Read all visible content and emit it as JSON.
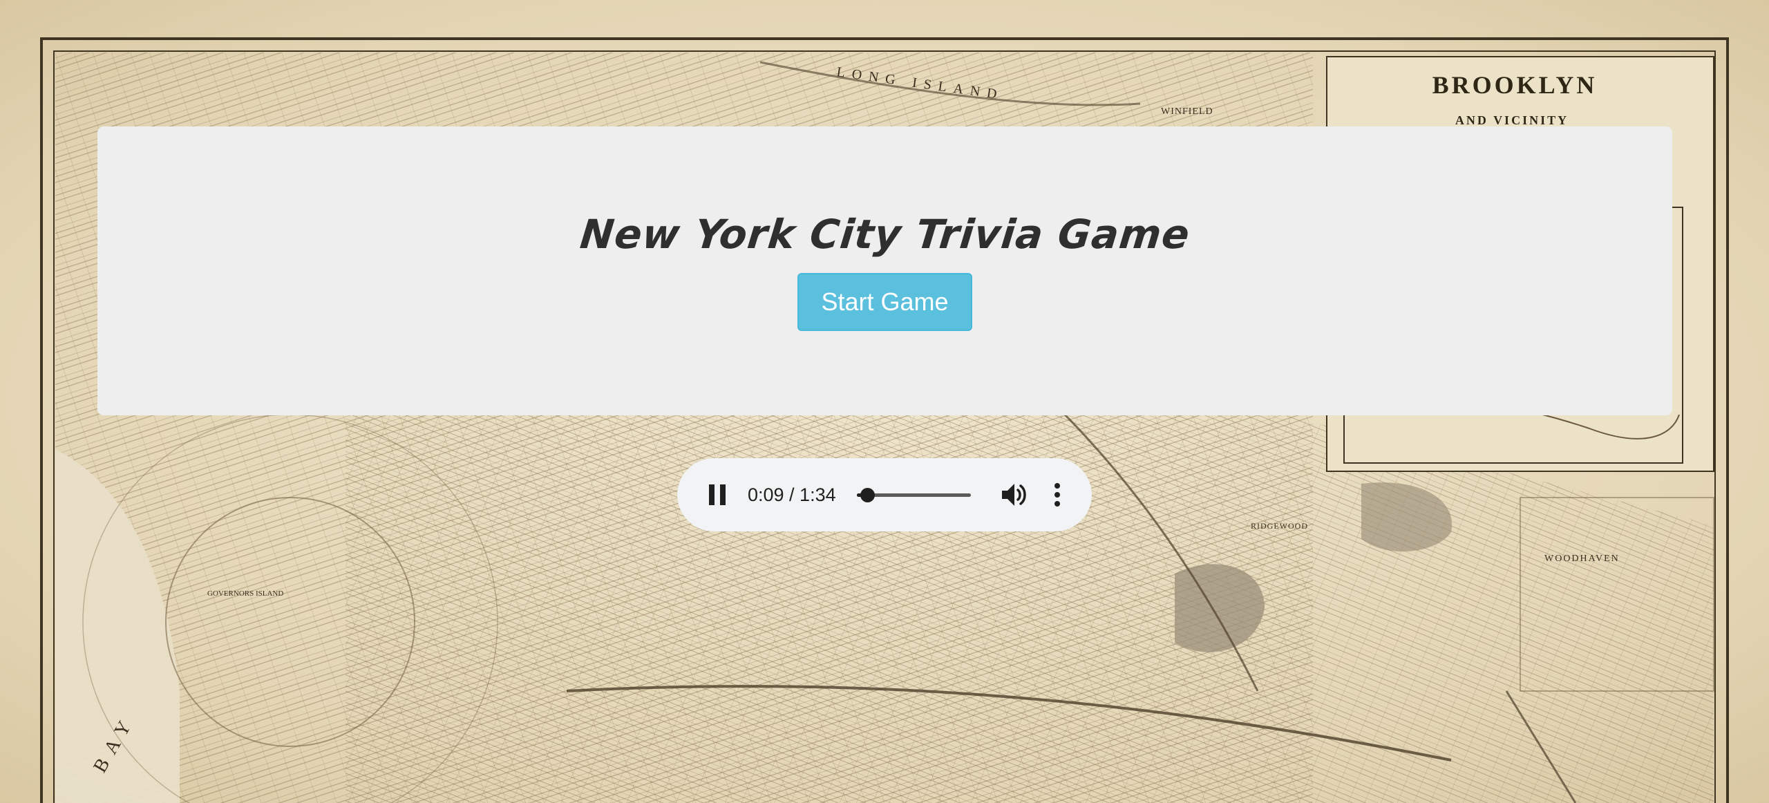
{
  "page": {
    "title": "New York City Trivia Game",
    "start_button_label": "Start Game"
  },
  "background": {
    "map_title": "BROOKLYN",
    "map_subtitle": "AND VICINITY",
    "map_labels": {
      "long_island": "LONG ISLAND",
      "winfield": "WINFIELD",
      "woodhaven": "WOODHAVEN",
      "ridgewood": "RIDGEWOOD",
      "governors_island": "GOVERNORS ISLAND",
      "bay": "BAY"
    }
  },
  "audio": {
    "state": "playing",
    "current_time": "0:09",
    "duration": "1:34",
    "time_display": "0:09 / 1:34",
    "progress": 0.096,
    "icons": {
      "pause": "pause-icon",
      "volume": "volume-icon",
      "more": "more-options-icon"
    }
  },
  "colors": {
    "jumbotron_bg": "#eeeeee",
    "button_bg": "#5bc0de",
    "button_border": "#46b8da",
    "player_bg": "#f1f3f4",
    "map_paper": "#e8dcc0",
    "map_ink": "#6b5a3e"
  }
}
